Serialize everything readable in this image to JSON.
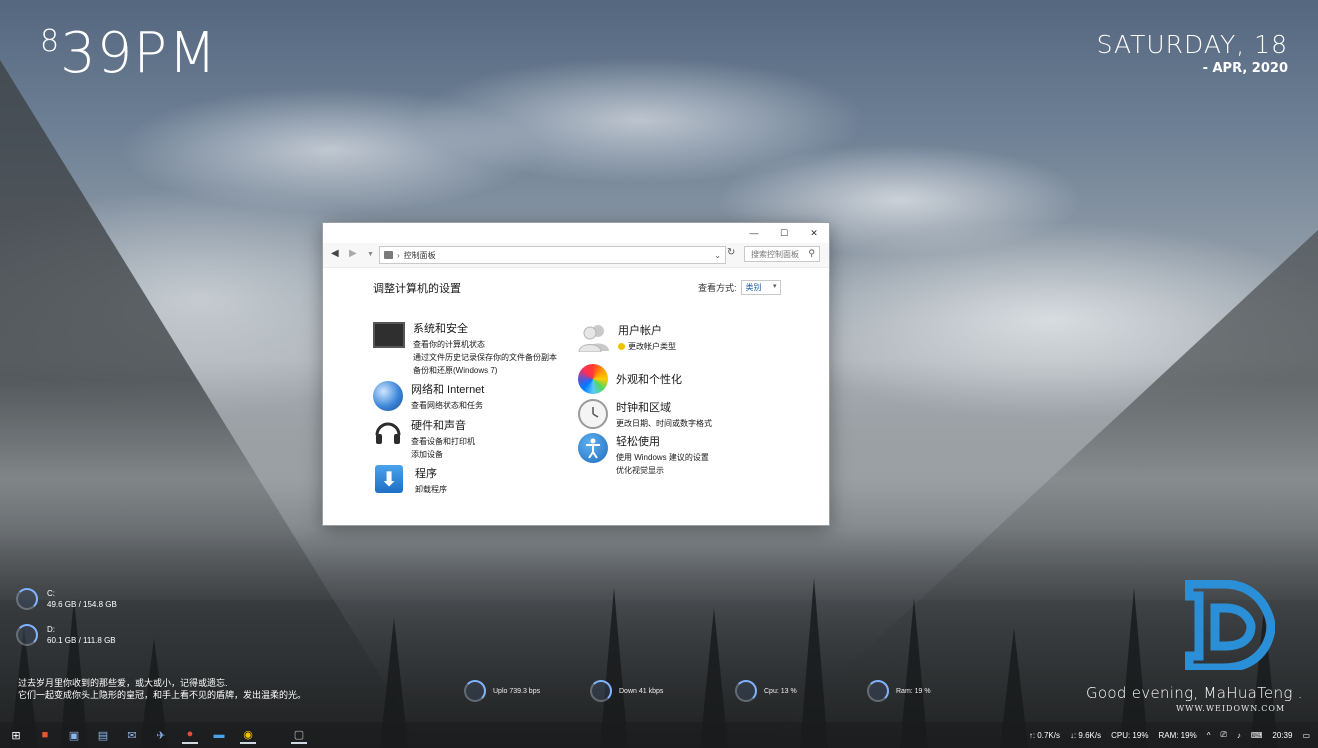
{
  "clock": {
    "hour": "8",
    "rest": "39PM"
  },
  "date": {
    "day": "SATURDAY, 18",
    "month": "- APR, 2020"
  },
  "window": {
    "address": "控制面板",
    "search_placeholder": "搜索控制面板",
    "page_title": "调整计算机的设置",
    "view_by_label": "查看方式:",
    "view_by_value": "类别",
    "left_categories": [
      {
        "title": "系统和安全",
        "links": [
          "查看你的计算机状态",
          "通过文件历史记录保存你的文件备份副本",
          "备份和还原(Windows 7)"
        ]
      },
      {
        "title": "网络和 Internet",
        "links": [
          "查看网络状态和任务"
        ]
      },
      {
        "title": "硬件和声音",
        "links": [
          "查看设备和打印机",
          "添加设备"
        ]
      },
      {
        "title": "程序",
        "links": [
          "卸载程序"
        ]
      }
    ],
    "right_categories": [
      {
        "title": "用户帐户",
        "links": [
          "更改帐户类型"
        ]
      },
      {
        "title": "外观和个性化",
        "links": []
      },
      {
        "title": "时钟和区域",
        "links": [
          "更改日期、时间或数字格式"
        ]
      },
      {
        "title": "轻松使用",
        "links": [
          "使用 Windows 建议的设置",
          "优化视觉显示"
        ]
      }
    ]
  },
  "drives": [
    {
      "name": "C:",
      "usage": "49.6 GB / 154.8 GB"
    },
    {
      "name": "D:",
      "usage": "60.1 GB / 111.8 GB"
    }
  ],
  "meters": {
    "upload": "Uplo 739.3 bps",
    "download": "Down 41 kbps",
    "cpu": "Cpu: 13 %",
    "ram": "Ram: 19 %"
  },
  "quote": {
    "line1": "过去岁月里你收到的那些爱，或大或小，记得或遗忘.",
    "line2": "它们一起变成你头上隐形的皇冠，和手上看不见的盾牌，发出温柔的光。"
  },
  "greeting": "Good evening, MaHuaTeng .",
  "watermark": "WWW.WEIDOWN.COM",
  "tray": {
    "up": "↑: 0.7K/s",
    "down": "↓: 9.6K/s",
    "cpu": "CPU: 19%",
    "ram": "RAM: 19%",
    "time": "20:39"
  },
  "colors": {
    "accent": "#1b5fa8",
    "logo_blue": "#2b8fd8"
  }
}
